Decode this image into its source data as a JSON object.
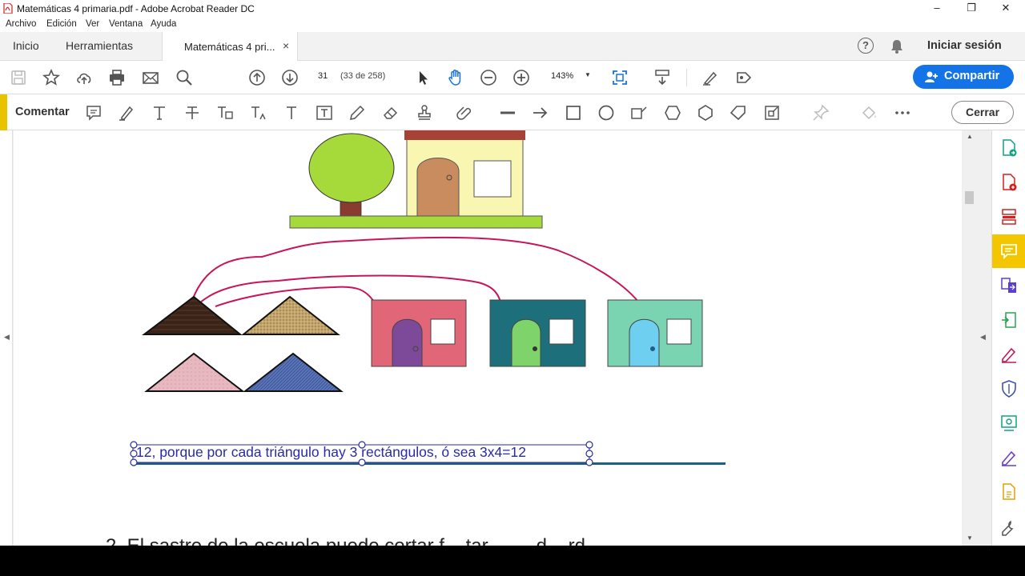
{
  "window": {
    "title": "Matemáticas 4 primaria.pdf - Adobe Acrobat Reader DC",
    "controls": {
      "minimize": "–",
      "restore": "❐",
      "close": "✕"
    }
  },
  "menu": [
    "Archivo",
    "Edición",
    "Ver",
    "Ventana",
    "Ayuda"
  ],
  "nav": {
    "home": "Inicio",
    "tools": "Herramientas",
    "doc_tab": "Matemáticas 4 pri...",
    "doc_tab_close": "×",
    "help": "?",
    "signin": "Iniciar sesión"
  },
  "toolbar": {
    "page_number": "31",
    "page_count": "(33 de 258)",
    "zoom": "143%",
    "zoom_caret": "▼",
    "share": "Compartir"
  },
  "comment_bar": {
    "label": "Comentar",
    "close": "Cerrar"
  },
  "document": {
    "answer_text": "12, porque por cada triángulo hay 3 rectángulos, ó sea 3x4=12",
    "next_question_partial": "2. El sastre de la escuela puede cortar f... tar ... ... d... rd..."
  },
  "scroll": {
    "up": "▲",
    "down": "▼",
    "left_arrow": "◀",
    "right_arrow": "◀"
  },
  "colors": {
    "share_blue": "#1473e6",
    "comment_accent": "#e8c400",
    "answer_text": "#2a2aa8",
    "connector_line": "#c8145a"
  }
}
